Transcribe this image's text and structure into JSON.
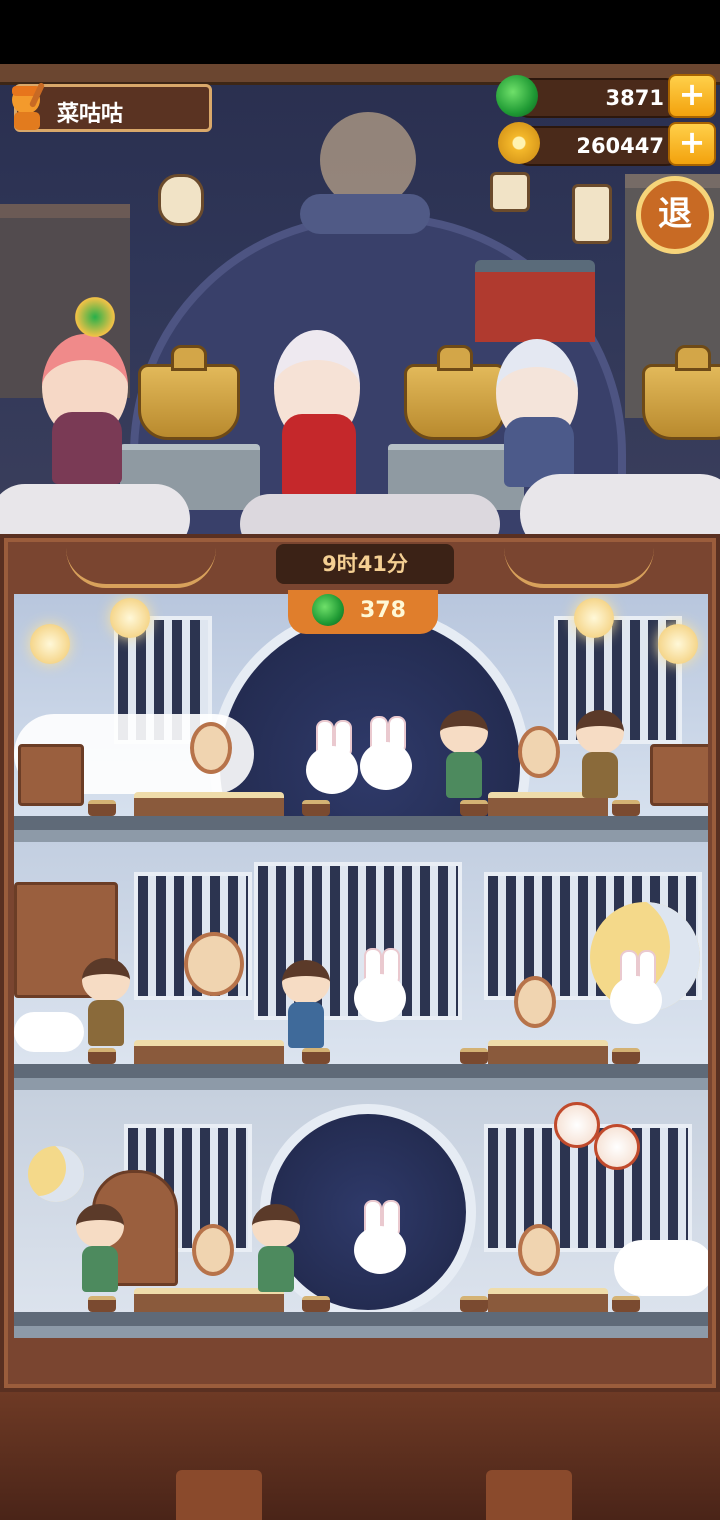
{
  "player": {
    "name": "菜咕咕"
  },
  "resources": {
    "jade": "3871",
    "coins": "260447",
    "plus_label": "+"
  },
  "exit_button": "退",
  "restaurant": {
    "time": "9时41分",
    "income": "378"
  },
  "colors": {
    "accent": "#f3a20d",
    "wood": "#5a3021",
    "jade": "#2fa23a"
  }
}
